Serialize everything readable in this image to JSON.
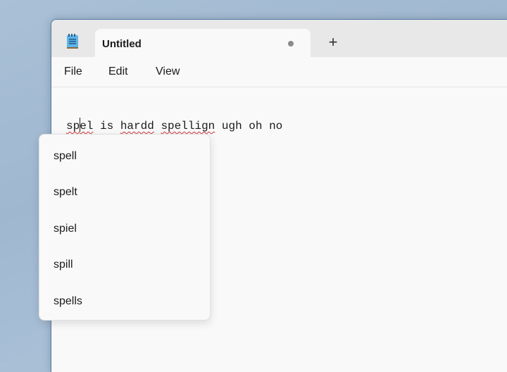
{
  "window": {
    "tab_title": "Untitled",
    "unsaved_indicator": "●",
    "new_tab_label": "+"
  },
  "menu": {
    "items": [
      {
        "label": "File"
      },
      {
        "label": "Edit"
      },
      {
        "label": "View"
      }
    ]
  },
  "editor": {
    "words": [
      {
        "text": "spel",
        "misspelled": true
      },
      {
        "text": " ",
        "misspelled": false
      },
      {
        "text": "is",
        "misspelled": false
      },
      {
        "text": " ",
        "misspelled": false
      },
      {
        "text": "hardd",
        "misspelled": true
      },
      {
        "text": " ",
        "misspelled": false
      },
      {
        "text": "spellign",
        "misspelled": true
      },
      {
        "text": " ugh oh no",
        "misspelled": false
      }
    ],
    "full_text": "spel is hardd spellign ugh oh no"
  },
  "spell_suggestions": {
    "items": [
      {
        "label": "spell"
      },
      {
        "label": "spelt"
      },
      {
        "label": "spiel"
      },
      {
        "label": "spill"
      },
      {
        "label": "spells"
      }
    ]
  },
  "colors": {
    "misspelling_underline": "#d13438",
    "window_border": "#4f78a8"
  }
}
